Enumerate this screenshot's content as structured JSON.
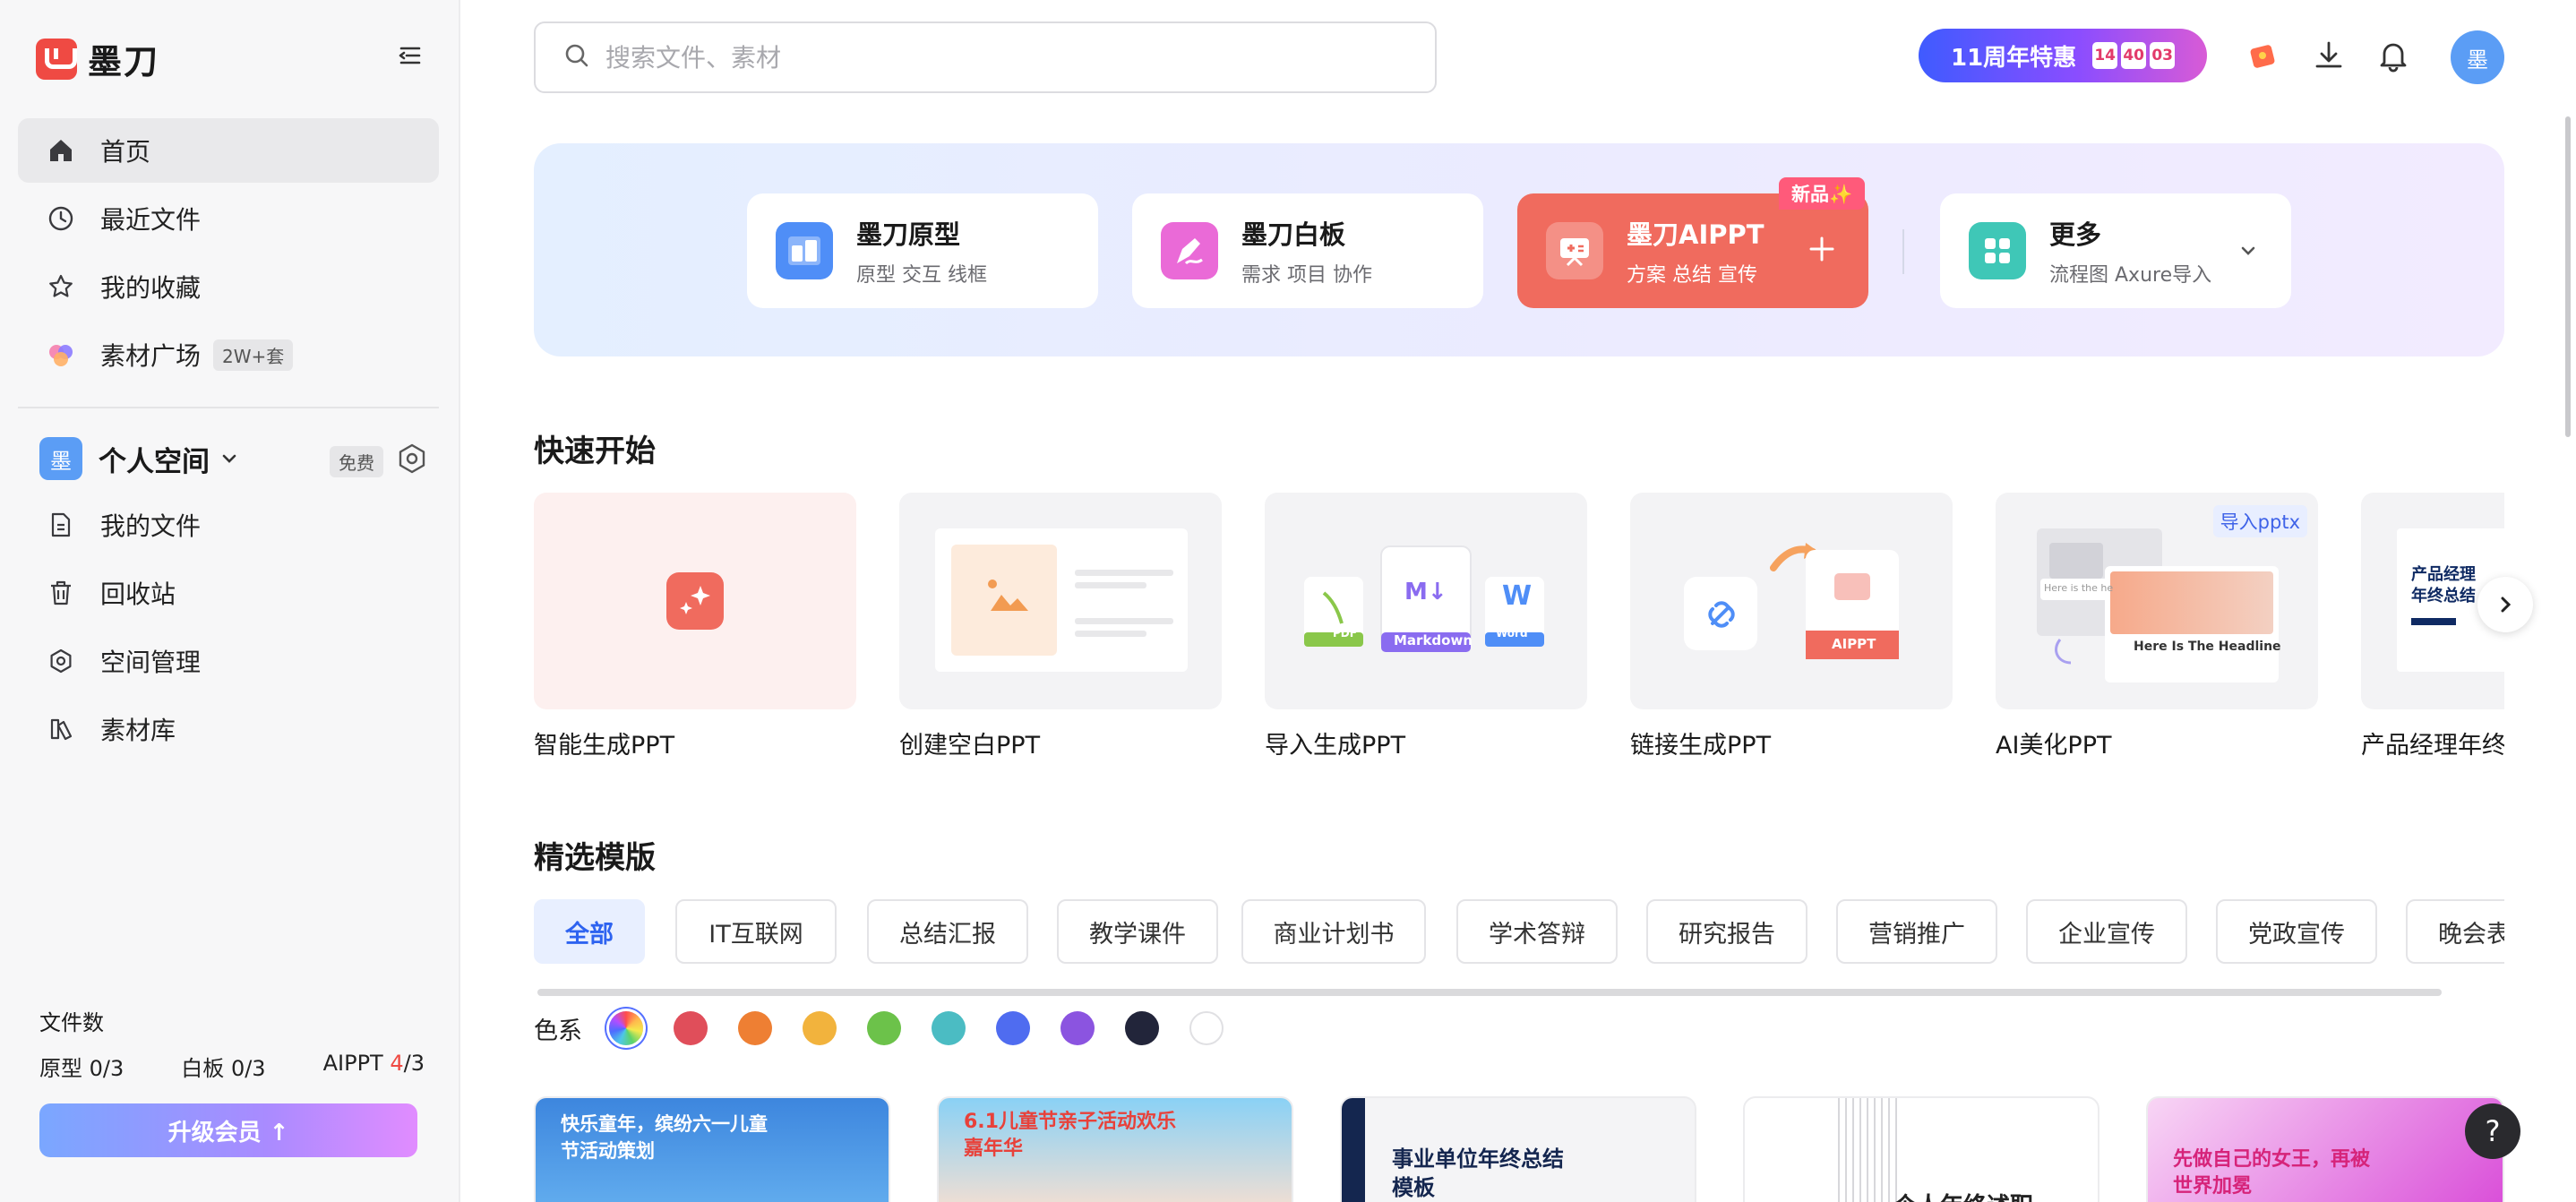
{
  "app": {
    "name": "墨刀"
  },
  "sidebar": {
    "nav": [
      {
        "label": "首页",
        "icon": "home-icon"
      },
      {
        "label": "最近文件",
        "icon": "clock-icon"
      },
      {
        "label": "我的收藏",
        "icon": "star-icon"
      },
      {
        "label": "素材广场",
        "icon": "material-square-icon",
        "badge": "2W+套"
      }
    ],
    "space": {
      "avatar": "墨",
      "name": "个人空间",
      "tag": "免费"
    },
    "space_nav": [
      {
        "label": "我的文件",
        "icon": "file-icon"
      },
      {
        "label": "回收站",
        "icon": "trash-icon"
      },
      {
        "label": "空间管理",
        "icon": "settings-hex-icon"
      },
      {
        "label": "素材库",
        "icon": "library-icon"
      }
    ],
    "file_count": {
      "title": "文件数",
      "proto_label": "原型",
      "proto_value": "0/3",
      "board_label": "白板",
      "board_value": "0/3",
      "ai_label": "AIPPT",
      "ai_used": "4",
      "ai_total": "/3"
    },
    "upgrade": "升级会员 ↑"
  },
  "header": {
    "search_placeholder": "搜索文件、素材",
    "promo": {
      "label": "11周年特惠",
      "timer": [
        "14",
        "40",
        "03"
      ]
    },
    "avatar": "墨"
  },
  "products": [
    {
      "name": "墨刀原型",
      "desc": "原型 交互 线框"
    },
    {
      "name": "墨刀白板",
      "desc": "需求 项目 协作"
    },
    {
      "name": "墨刀AIPPT",
      "desc": "方案 总结 宣传",
      "tag": "新品✨"
    },
    {
      "name": "更多",
      "desc": "流程图 Axure导入"
    }
  ],
  "quick_start": {
    "title": "快速开始",
    "items": [
      {
        "label": "智能生成PPT"
      },
      {
        "label": "创建空白PPT"
      },
      {
        "label": "导入生成PPT"
      },
      {
        "label": "链接生成PPT"
      },
      {
        "label": "AI美化PPT"
      },
      {
        "label": "产品经理年终"
      }
    ],
    "import_badges": {
      "pdf": "PDF",
      "md": "Markdown",
      "word": "Word",
      "md_glyph": "M↓",
      "word_glyph": "W"
    },
    "aippt_badge": "AIPPT",
    "beautify_badge": "导入pptx",
    "beautify_headline": "Here Is The Headline",
    "beautify_sub": "Here is the he",
    "pm_thumb_title": "产品经理年终总结"
  },
  "templates": {
    "title": "精选模版",
    "tabs": [
      "全部",
      "IT互联网",
      "总结汇报",
      "教学课件",
      "商业计划书",
      "学术答辩",
      "研究报告",
      "营销推广",
      "企业宣传",
      "党政宣传",
      "晚会表演"
    ],
    "colors_label": "色系",
    "colors": [
      "#e04e5a",
      "#ee7f33",
      "#f2b33d",
      "#6cc24a",
      "#4bbcc3",
      "#4f6cf0",
      "#8b54e0",
      "#22253a",
      "#ffffff"
    ],
    "cards": [
      {
        "title": "快乐童年，缤纷六一儿童节活动策划"
      },
      {
        "title": "6.1儿童节亲子活动欢乐嘉年华"
      },
      {
        "title": "事业单位年终总结模板"
      },
      {
        "title": "个人年终述职"
      },
      {
        "title": "先做自己的女王，再被世界加冕"
      }
    ]
  },
  "help": "?"
}
